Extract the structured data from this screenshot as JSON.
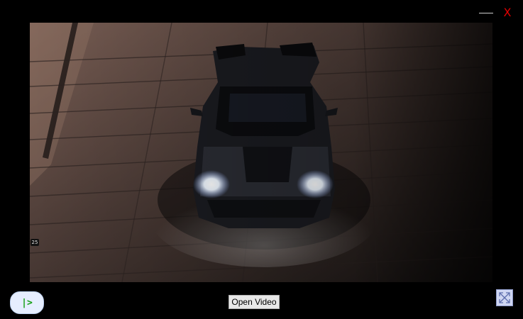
{
  "window_controls": {
    "minimize_icon": "minimize-icon",
    "close_label": "X",
    "close_color": "#e00000"
  },
  "video": {
    "frame_badge": "25"
  },
  "controls": {
    "play_label": "|>",
    "open_video_label": "Open Video",
    "fullscreen_icon": "expand-arrows-icon"
  }
}
